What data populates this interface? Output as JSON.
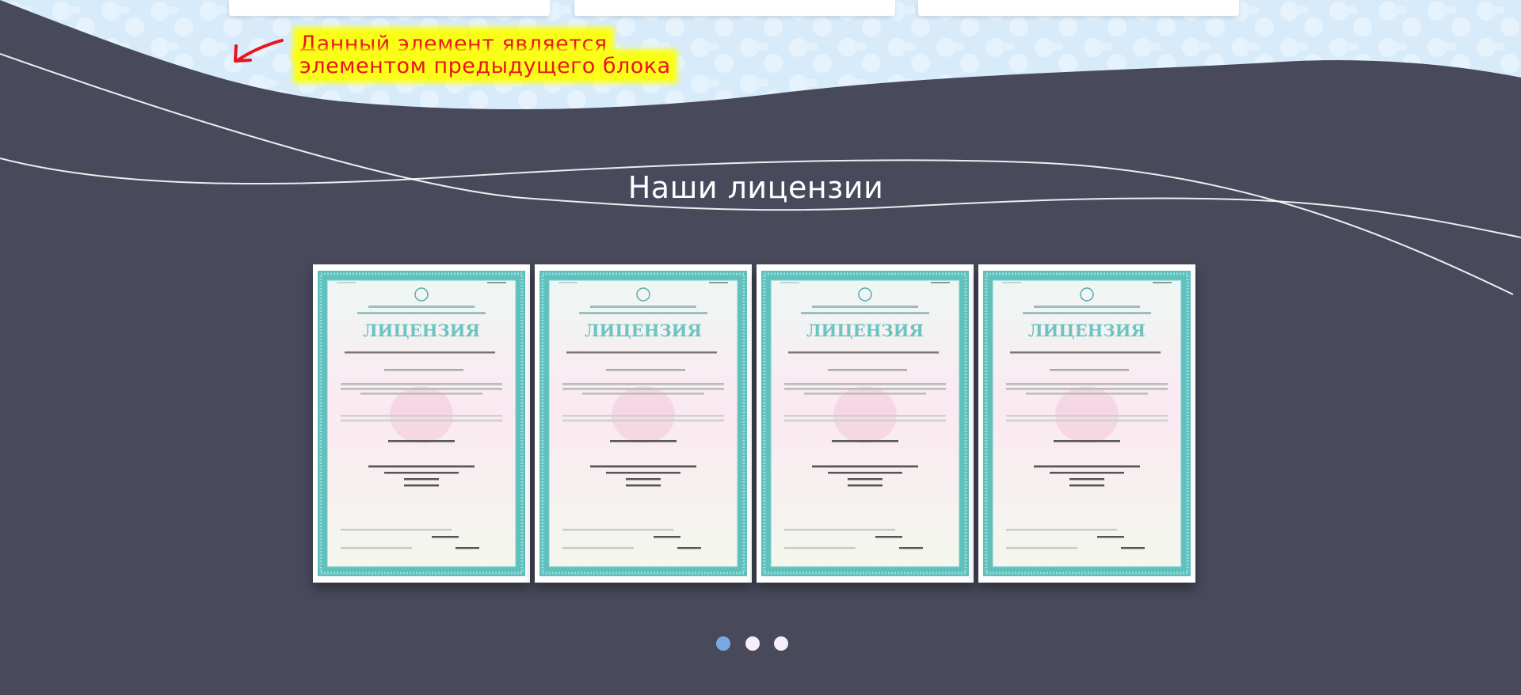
{
  "annotation": {
    "line1": "Данный элемент является",
    "line2": "элементом предыдущего блока"
  },
  "section": {
    "title": "Наши лицензии"
  },
  "licenses": {
    "items": [
      {
        "heading": "ЛИЦЕНЗИЯ"
      },
      {
        "heading": "ЛИЦЕНЗИЯ"
      },
      {
        "heading": "ЛИЦЕНЗИЯ"
      },
      {
        "heading": "ЛИЦЕНЗИЯ"
      }
    ]
  },
  "pagination": {
    "count": 3,
    "active_index": 0
  },
  "colors": {
    "background": "#484a5c",
    "wave_light": "#dbeefd",
    "annotation_text": "#e8141e",
    "annotation_highlight": "#fbff18",
    "dot_active": "#7aa9e6",
    "dot_inactive": "#f6eefa",
    "certificate_border": "#5fc1be"
  }
}
